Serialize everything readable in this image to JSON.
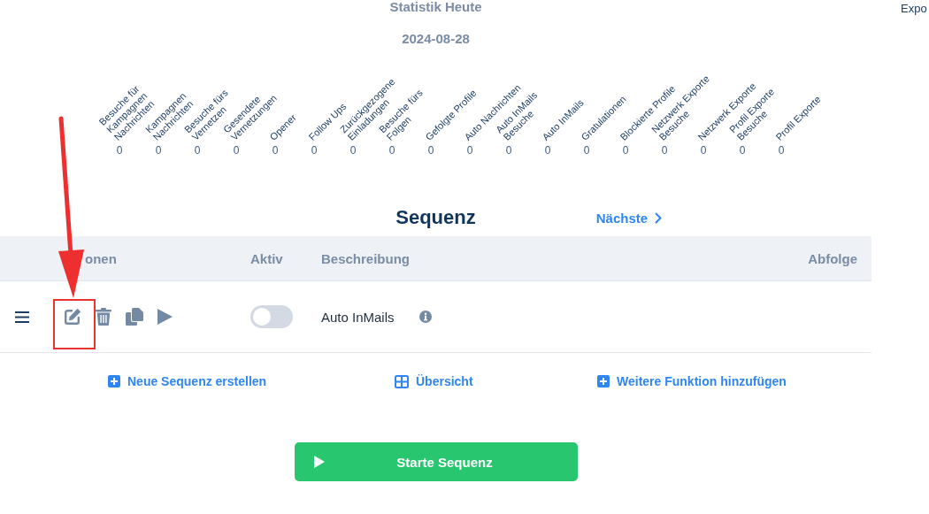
{
  "header": {
    "title": "Statistik Heute",
    "date": "2024-08-28",
    "corner_text": "Expo"
  },
  "stats": [
    {
      "label": "Besuche für Kampagnen Nachrichten",
      "value": "0"
    },
    {
      "label": "Kampagnen Nachrichten",
      "value": "0"
    },
    {
      "label": "Besuche fürs Vernetzen",
      "value": "0"
    },
    {
      "label": "Gesendete Vernetzungen",
      "value": "0"
    },
    {
      "label": "Opener",
      "value": "0"
    },
    {
      "label": "Follow Ups",
      "value": "0"
    },
    {
      "label": "Zurückgezogene Einladungen",
      "value": "0"
    },
    {
      "label": "Besuche fürs Folgen",
      "value": "0"
    },
    {
      "label": "Gefolgte Profile",
      "value": "0"
    },
    {
      "label": "Auto Nachrichten",
      "value": "0"
    },
    {
      "label": "Auto InMails Besuche",
      "value": "0"
    },
    {
      "label": "Auto InMails",
      "value": "0"
    },
    {
      "label": "Gratulationen",
      "value": "0"
    },
    {
      "label": "Blockierte Profile",
      "value": "0"
    },
    {
      "label": "Netzwerk Exporte Besuche",
      "value": "0"
    },
    {
      "label": "Netzwerk Exporte",
      "value": "0"
    },
    {
      "label": "Profil Exporte Besuche",
      "value": "0"
    },
    {
      "label": "Profil Exporte",
      "value": "0"
    }
  ],
  "sequence": {
    "title": "Sequenz",
    "next_link": "Nächste",
    "columns": [
      "onen",
      "Aktiv",
      "Beschreibung",
      "Abfolge"
    ],
    "rows": [
      {
        "actions": [
          {
            "kind": "edit",
            "highlighted": true
          },
          {
            "kind": "delete",
            "highlighted": false
          },
          {
            "kind": "copy",
            "highlighted": false
          },
          {
            "kind": "run",
            "highlighted": false
          }
        ],
        "active": false,
        "description": "Auto InMails"
      }
    ]
  },
  "links": [
    {
      "kind": "add",
      "label": "Neue Sequenz erstellen"
    },
    {
      "kind": "grid",
      "label": "Übersicht"
    },
    {
      "kind": "add",
      "label": "Weitere Funktion hinzufügen"
    }
  ],
  "start_button": {
    "label": "Starte Sequenz"
  }
}
